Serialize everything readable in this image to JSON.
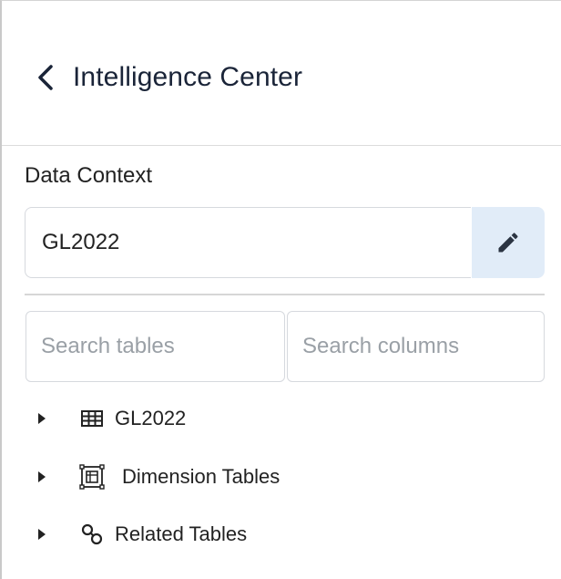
{
  "header": {
    "back_icon": "chevron-left-icon",
    "title": "Intelligence Center"
  },
  "data_context": {
    "label": "Data Context",
    "value": "GL2022",
    "edit_icon": "pencil-icon"
  },
  "search": {
    "tables_placeholder": "Search tables",
    "columns_placeholder": "Search columns"
  },
  "tree": {
    "items": [
      {
        "label": "GL2022",
        "icon": "table-icon",
        "expanded": false
      },
      {
        "label": "Dimension Tables",
        "icon": "dimension-tables-icon",
        "expanded": false
      },
      {
        "label": "Related Tables",
        "icon": "link-icon",
        "expanded": false
      }
    ]
  },
  "colors": {
    "title_text": "#1a2438",
    "edit_button_bg": "#e1ecf8",
    "border": "#d6d9de",
    "placeholder": "#9aa0a6"
  }
}
